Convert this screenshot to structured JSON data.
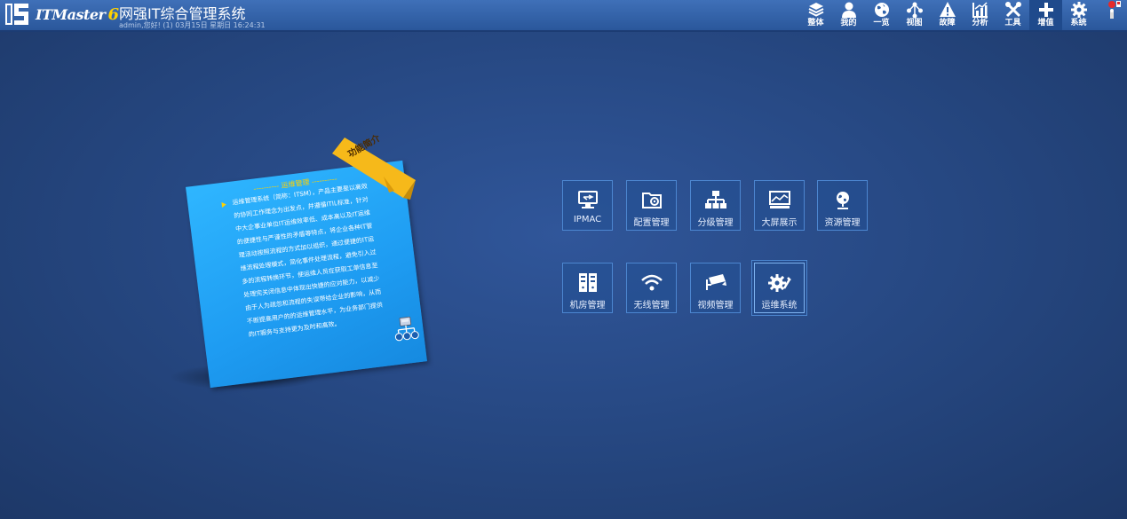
{
  "header": {
    "brand_name": "ITMaster",
    "brand_version": "6",
    "app_title": "网强IT综合管理系统",
    "user_info": "admin,您好! (1) 03月15日 星期日 16:24:31"
  },
  "nav": {
    "items": [
      {
        "label": "整体",
        "icon": "layers-icon"
      },
      {
        "label": "我的",
        "icon": "user-icon"
      },
      {
        "label": "一览",
        "icon": "globe-icon"
      },
      {
        "label": "视图",
        "icon": "network-icon"
      },
      {
        "label": "故障",
        "icon": "warning-icon"
      },
      {
        "label": "分析",
        "icon": "chart-icon"
      },
      {
        "label": "工具",
        "icon": "tools-icon"
      },
      {
        "label": "增值",
        "icon": "plus-icon"
      },
      {
        "label": "系统",
        "icon": "gear-icon"
      }
    ],
    "active": "增值"
  },
  "intro": {
    "ribbon": "功能简介",
    "title": "运维管理",
    "text": "运维管理系统（简称：ITSM），产品主要是以高效的协同工作理念为出发点，并遵循ITIL标准，针对中大企事业单位IT运维效率低、成本高以及IT运维的便捷性与严谨性的矛盾等特点，将企业各种IT管理活动按照流程的方式加以组织，通过便捷的IT运维流程处理模式，简化事件处理流程，避免引入过多的流程转换环节，使运维人员在获取工单信息至处理完关闭信息中体现出快捷的应对能力，以减少由于人为疏忽和流程的失误带给企业的影响，从而不断提高用户的的运维管理水平，为业务部门提供的IT服务与支持更为及时和高效。"
  },
  "modules": [
    {
      "label": "IPMAC",
      "icon": "monitor-network-icon"
    },
    {
      "label": "配置管理",
      "icon": "folder-gear-icon"
    },
    {
      "label": "分级管理",
      "icon": "hierarchy-icon"
    },
    {
      "label": "大屏展示",
      "icon": "screen-chart-icon"
    },
    {
      "label": "资源管理",
      "icon": "globe-stand-icon"
    },
    {
      "label": "机房管理",
      "icon": "server-rack-icon"
    },
    {
      "label": "无线管理",
      "icon": "wifi-icon"
    },
    {
      "label": "视频管理",
      "icon": "camera-icon"
    },
    {
      "label": "运维系统",
      "icon": "gears-icon"
    }
  ],
  "active_module": "运维系统",
  "colors": {
    "header": "#2f62ab",
    "background": "#25467f",
    "card": "#1e9cf2",
    "ribbon": "#f6b91a",
    "accent": "#ffd200"
  }
}
